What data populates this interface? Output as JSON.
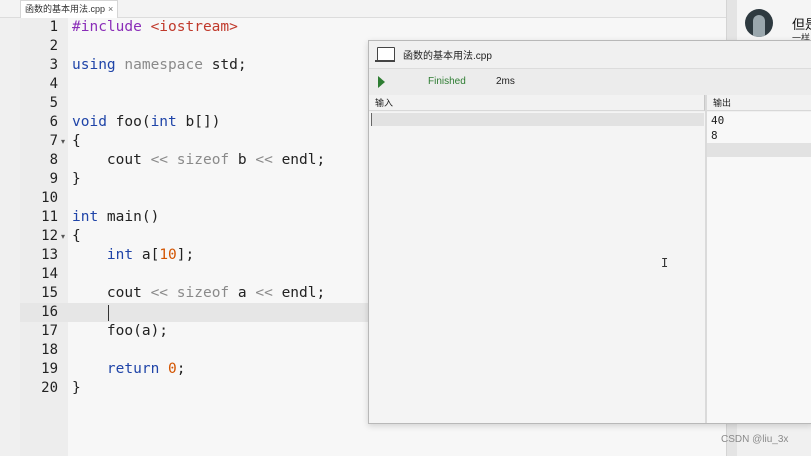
{
  "tab": {
    "label": "函数的基本用法.cpp",
    "close": "×"
  },
  "editor": {
    "lines": [
      {
        "n": "1",
        "fold": "",
        "segs": [
          {
            "t": "#include ",
            "c": "pp"
          },
          {
            "t": "<iostream>",
            "c": "inc"
          }
        ]
      },
      {
        "n": "2",
        "fold": "",
        "segs": []
      },
      {
        "n": "3",
        "fold": "",
        "segs": [
          {
            "t": "using ",
            "c": "kw"
          },
          {
            "t": "namespace",
            "c": "op"
          },
          {
            "t": " std;",
            "c": ""
          }
        ]
      },
      {
        "n": "4",
        "fold": "",
        "segs": []
      },
      {
        "n": "5",
        "fold": "",
        "segs": []
      },
      {
        "n": "6",
        "fold": "",
        "segs": [
          {
            "t": "void",
            "c": "kw"
          },
          {
            "t": " foo(",
            "c": ""
          },
          {
            "t": "int",
            "c": "kw"
          },
          {
            "t": " b[])",
            "c": ""
          }
        ]
      },
      {
        "n": "7",
        "fold": "▾",
        "segs": [
          {
            "t": "{",
            "c": ""
          }
        ]
      },
      {
        "n": "8",
        "fold": "",
        "segs": [
          {
            "t": "    cout ",
            "c": ""
          },
          {
            "t": "<<",
            "c": "op"
          },
          {
            "t": " ",
            "c": ""
          },
          {
            "t": "sizeof",
            "c": "op"
          },
          {
            "t": " b ",
            "c": ""
          },
          {
            "t": "<<",
            "c": "op"
          },
          {
            "t": " endl;",
            "c": ""
          }
        ]
      },
      {
        "n": "9",
        "fold": "",
        "segs": [
          {
            "t": "}",
            "c": ""
          }
        ]
      },
      {
        "n": "10",
        "fold": "",
        "segs": []
      },
      {
        "n": "11",
        "fold": "",
        "segs": [
          {
            "t": "int",
            "c": "kw"
          },
          {
            "t": " main()",
            "c": ""
          }
        ]
      },
      {
        "n": "12",
        "fold": "▾",
        "segs": [
          {
            "t": "{",
            "c": ""
          }
        ]
      },
      {
        "n": "13",
        "fold": "",
        "segs": [
          {
            "t": "    ",
            "c": ""
          },
          {
            "t": "int",
            "c": "kw"
          },
          {
            "t": " a[",
            "c": ""
          },
          {
            "t": "10",
            "c": "num"
          },
          {
            "t": "];",
            "c": ""
          }
        ]
      },
      {
        "n": "14",
        "fold": "",
        "segs": []
      },
      {
        "n": "15",
        "fold": "",
        "segs": [
          {
            "t": "    cout ",
            "c": ""
          },
          {
            "t": "<<",
            "c": "op"
          },
          {
            "t": " ",
            "c": ""
          },
          {
            "t": "sizeof",
            "c": "op"
          },
          {
            "t": " a ",
            "c": ""
          },
          {
            "t": "<<",
            "c": "op"
          },
          {
            "t": " endl;",
            "c": ""
          }
        ]
      },
      {
        "n": "16",
        "fold": "",
        "segs": []
      },
      {
        "n": "17",
        "fold": "",
        "segs": [
          {
            "t": "    foo(a);",
            "c": ""
          }
        ]
      },
      {
        "n": "18",
        "fold": "",
        "segs": []
      },
      {
        "n": "19",
        "fold": "",
        "segs": [
          {
            "t": "    ",
            "c": ""
          },
          {
            "t": "return",
            "c": "kw"
          },
          {
            "t": " ",
            "c": ""
          },
          {
            "t": "0",
            "c": "num"
          },
          {
            "t": ";",
            "c": ""
          }
        ]
      },
      {
        "n": "20",
        "fold": "",
        "segs": [
          {
            "t": "}",
            "c": ""
          }
        ]
      }
    ]
  },
  "chat": {
    "line1": "但是",
    "line2": "一样"
  },
  "run_window": {
    "title": "函数的基本用法.cpp",
    "status": "Finished",
    "time": "2ms",
    "input_header": "输入",
    "output_header": "输出",
    "output_lines": [
      "40",
      "8"
    ]
  },
  "watermark": "CSDN @liu_3x",
  "colors": {
    "keyword": "#1f44a8",
    "preprocessor": "#8a2db8",
    "include": "#c0392b",
    "number": "#d35400",
    "finished": "#2e7d32"
  }
}
